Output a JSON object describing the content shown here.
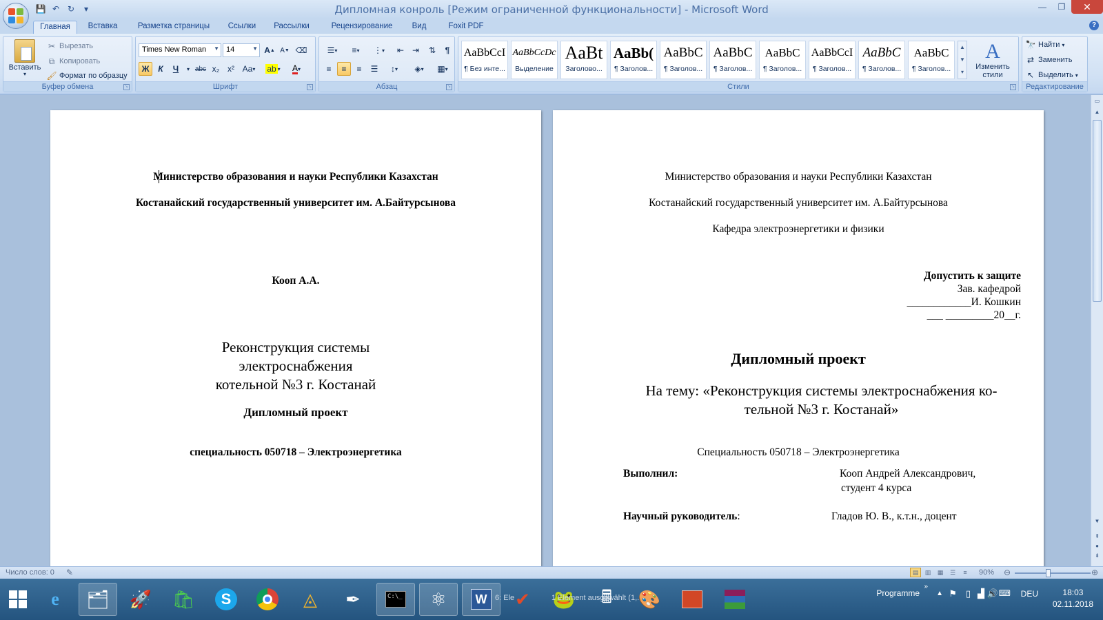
{
  "window": {
    "title": "Дипломная конроль [Режим ограниченной функциональности] - Microsoft Word"
  },
  "tabs": [
    "Главная",
    "Вставка",
    "Разметка страницы",
    "Ссылки",
    "Рассылки",
    "Рецензирование",
    "Вид",
    "Foxit PDF"
  ],
  "ribbon": {
    "clipboard": {
      "label": "Буфер обмена",
      "paste": "Вставить",
      "cut": "Вырезать",
      "copy": "Копировать",
      "format_painter": "Формат по образцу"
    },
    "font": {
      "label": "Шрифт",
      "font_name": "Times New Roman",
      "font_size": "14",
      "bold": "Ж",
      "italic": "К",
      "underline": "Ч",
      "strike": "abc",
      "subscript": "x₂",
      "superscript": "x²",
      "change_case": "Aa",
      "grow": "A",
      "shrink": "A"
    },
    "paragraph": {
      "label": "Абзац"
    },
    "styles": {
      "label": "Стили",
      "items": [
        {
          "preview": "AaBbCcI",
          "name": "¶ Без инте..."
        },
        {
          "preview": "AaBbCcDc",
          "name": "Выделение"
        },
        {
          "preview": "AaBt",
          "name": "Заголово..."
        },
        {
          "preview": "AaBb(",
          "name": "¶ Заголов..."
        },
        {
          "preview": "AaBbC",
          "name": "¶ Заголов..."
        },
        {
          "preview": "AaBbC",
          "name": "¶ Заголов..."
        },
        {
          "preview": "AaBbC",
          "name": "¶ Заголов..."
        },
        {
          "preview": "AaBbCcI",
          "name": "¶ Заголов..."
        },
        {
          "preview": "AaBbC",
          "name": "¶ Заголов..."
        },
        {
          "preview": "AaBbC",
          "name": "¶ Заголов..."
        }
      ],
      "change_styles": "Изменить стили"
    },
    "editing": {
      "label": "Редактирование",
      "find": "Найти",
      "replace": "Заменить",
      "select": "Выделить"
    }
  },
  "page1": {
    "ministry": "Министерство образования и науки Республики Казахстан",
    "university": "Костанайский государственный университет им. А.Байтурсынова",
    "author": "Кооп А.А.",
    "title": "Реконструкция системы электроснабжения котельной №3 г. Костанай",
    "doc_type": "Дипломный проект",
    "specialty": "специальность 050718 – Электроэнергетика"
  },
  "page2": {
    "ministry": "Министерство образования и науки Республики Казахстан",
    "university": "Костанайский государственный университет им. А.Байтурсынова",
    "department": "Кафедра электроэнергетики и физики",
    "approve_1": "Допустить  к защите",
    "approve_2": "Зав. кафедрой",
    "approve_3": "____________И. Кошкин",
    "approve_4": "___ _________20__г.",
    "doc_type": "Дипломный проект",
    "topic": "На тему: «Реконструкция системы электроснабжения ко-тельной №3 г. Костанай»",
    "specialty": "Специальность 050718 – Электроэнергетика",
    "performed_label": "Выполнил:",
    "performed_value": "Кооп Андрей Александрович,",
    "performed_value_2": "студент 4 курса",
    "supervisor_label": "Научный руководитель",
    "supervisor_colon": ":",
    "supervisor_value": "Гладов Ю. В.,  к.т.н., доцент"
  },
  "status": {
    "word_count": "Число слов: 0",
    "zoom": "90%"
  },
  "taskbar": {
    "text_1": "6: Ele",
    "text_2": "1 Element ausgewählt (1,...",
    "programme": "Programme",
    "lang": "DEU",
    "time": "18:03",
    "date": "02.11.2018"
  }
}
